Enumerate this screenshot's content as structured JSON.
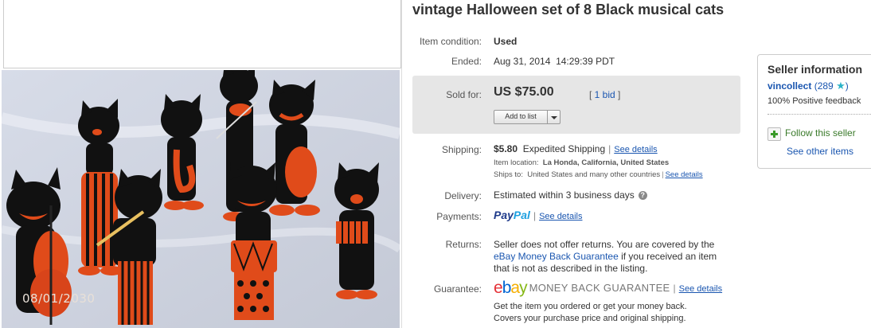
{
  "photo": {
    "date_stamp": "08/01/2030"
  },
  "title": "vintage Halloween set of 8 Black musical cats",
  "condition": {
    "label": "Item condition:",
    "value": "Used"
  },
  "ended": {
    "label": "Ended:",
    "value": "Aug 31, 2014  14:29:39 PDT"
  },
  "sold": {
    "label": "Sold for:",
    "price": "US $75.00",
    "bid_prefix": "[ ",
    "bid_link": "1 bid",
    "bid_suffix": " ]",
    "add_to_list": "Add to list"
  },
  "shipping": {
    "label": "Shipping:",
    "cost": "$5.80",
    "method": "Expedited Shipping",
    "see_details": "See details",
    "location_label": "Item location:",
    "location": "La Honda, California, United States",
    "ships_to_label": "Ships to:",
    "ships_to": "United States and many other countries",
    "see_details2": "See details"
  },
  "delivery": {
    "label": "Delivery:",
    "value": "Estimated within 3 business days",
    "help_icon": "?"
  },
  "payments": {
    "label": "Payments:",
    "paypal_a": "Pay",
    "paypal_b": "Pal",
    "see_details": "See details"
  },
  "returns": {
    "label": "Returns:",
    "line1": "Seller does not offer returns. You are covered by the",
    "link": "eBay Money Back Guarantee",
    "line2_rest": " if you received an item",
    "line3": "that is not as described in the listing."
  },
  "guarantee": {
    "label": "Guarantee:",
    "logo_e": "e",
    "logo_b": "b",
    "logo_a": "a",
    "logo_y": "y",
    "mbg": "MONEY BACK GUARANTEE",
    "see_details": "See details",
    "line1": "Get the item you ordered or get your money back.",
    "line2": "Covers your purchase price and original shipping."
  },
  "seller": {
    "heading": "Seller information",
    "name": "vincollect",
    "score_open": "(289 ",
    "star": "★",
    "score_close": ")",
    "positive": "100% Positive feedback",
    "follow": "Follow this seller",
    "other_items": "See other items"
  },
  "colors": {
    "accent_link": "#1a56b0",
    "sold_bg": "#e6e6e6",
    "follow_green": "#3a9a2a"
  }
}
